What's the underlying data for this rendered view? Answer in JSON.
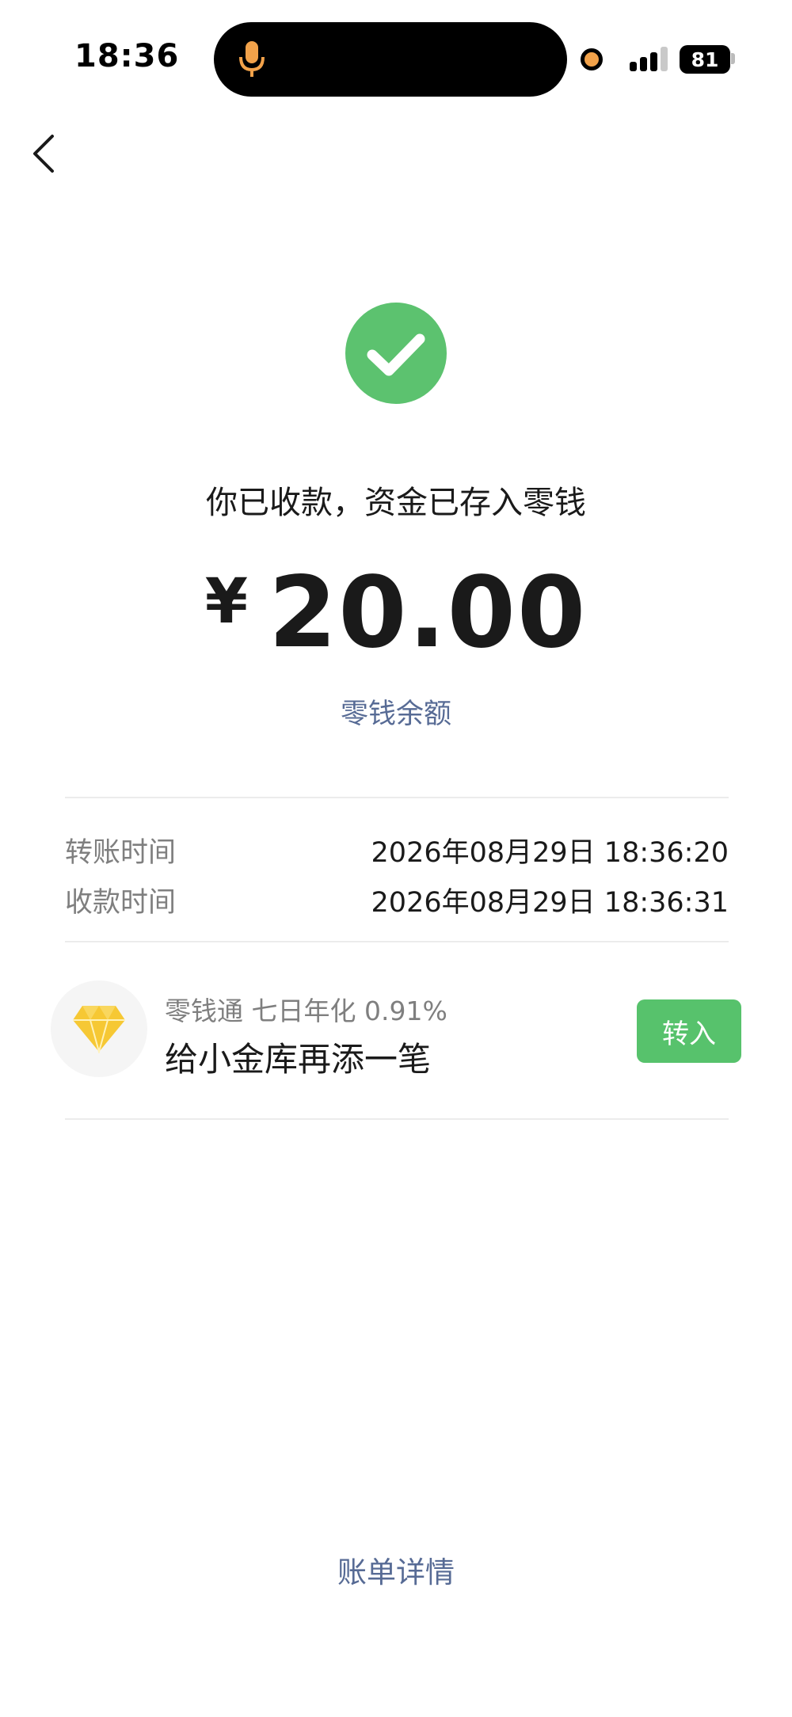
{
  "status_bar": {
    "time": "18:36",
    "battery": "81",
    "icons": [
      "microphone-icon",
      "recording-dot",
      "signal-icon",
      "battery-icon"
    ]
  },
  "nav": {
    "back_icon": "chevron-left-icon"
  },
  "result": {
    "icon": "check-circle-icon",
    "message": "你已收款，资金已存入零钱",
    "currency": "¥",
    "amount": "20.00",
    "balance_link": "零钱余额"
  },
  "details": [
    {
      "label": "转账时间",
      "value": "2026年08月29日 18:36:20"
    },
    {
      "label": "收款时间",
      "value": "2026年08月29日 18:36:31"
    }
  ],
  "promo": {
    "icon": "diamond-icon",
    "subtitle": "零钱通 七日年化 0.91%",
    "title": "给小金库再添一笔",
    "button": "转入"
  },
  "footer": {
    "bill_link": "账单详情"
  },
  "colors": {
    "accent_green": "#57c26c",
    "success_green": "#5cc26f",
    "link_blue": "#576b95",
    "diamond_yellow": "#f6c834"
  }
}
